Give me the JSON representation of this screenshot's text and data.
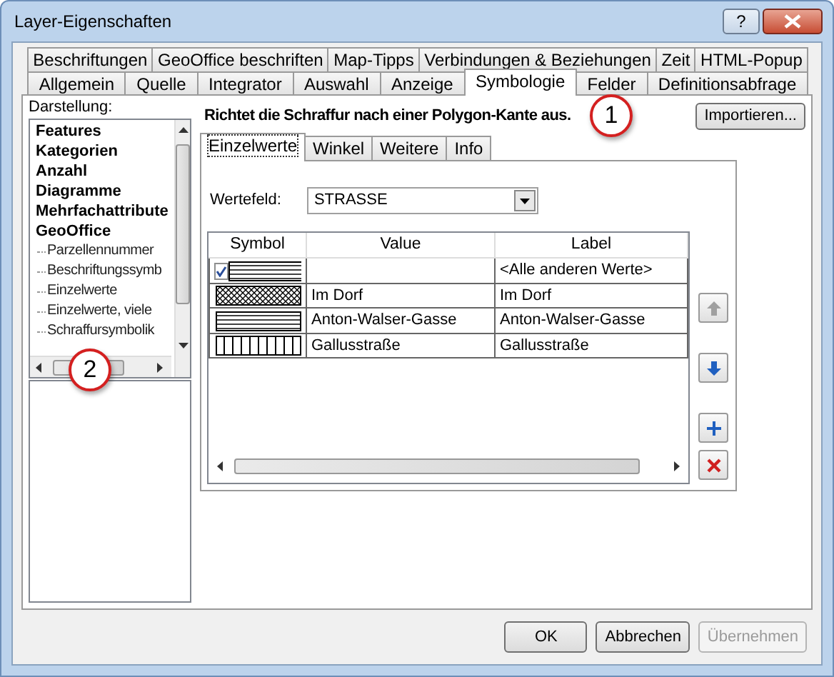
{
  "window": {
    "title": "Layer-Eigenschaften",
    "help": "?"
  },
  "tab_rows": [
    [
      {
        "label": "Beschriftungen",
        "selected": false
      },
      {
        "label": "GeoOffice beschriften",
        "selected": false
      },
      {
        "label": "Map-Tipps",
        "selected": false
      },
      {
        "label": "Verbindungen & Beziehungen",
        "selected": false
      },
      {
        "label": "Zeit",
        "selected": false
      },
      {
        "label": "HTML-Popup",
        "selected": false
      }
    ],
    [
      {
        "label": "Allgemein",
        "selected": false
      },
      {
        "label": "Quelle",
        "selected": false
      },
      {
        "label": "Integrator",
        "selected": false
      },
      {
        "label": "Auswahl",
        "selected": false
      },
      {
        "label": "Anzeige",
        "selected": false
      },
      {
        "label": "Symbologie",
        "selected": true
      },
      {
        "label": "Felder",
        "selected": false
      },
      {
        "label": "Definitionsabfrage",
        "selected": false
      }
    ]
  ],
  "sidebar": {
    "label": "Darstellung:",
    "items": [
      {
        "label": "Features"
      },
      {
        "label": "Kategorien"
      },
      {
        "label": "Anzahl"
      },
      {
        "label": "Diagramme"
      },
      {
        "label": "Mehrfachattribute"
      },
      {
        "label": "GeoOffice",
        "children": [
          {
            "label": "Parzellennummer"
          },
          {
            "label": "Beschriftungssymb"
          },
          {
            "label": "Einzelwerte"
          },
          {
            "label": "Einzelwerte, viele"
          },
          {
            "label": "Schraffursymbolik"
          }
        ]
      }
    ]
  },
  "description": "Richtet die Schraffur nach einer Polygon-Kante aus.",
  "import_button": "Importieren...",
  "inner_tabs": [
    {
      "label": "Einzelwerte",
      "selected": true
    },
    {
      "label": "Winkel",
      "selected": false
    },
    {
      "label": "Weitere",
      "selected": false
    },
    {
      "label": "Info",
      "selected": false
    }
  ],
  "value_field": {
    "label": "Wertefeld:",
    "value": "STRASSE"
  },
  "table": {
    "columns": [
      "Symbol",
      "Value",
      "Label"
    ],
    "rows": [
      {
        "kind": "horizontal",
        "checked": true,
        "label": "<Alle anderen Werte>"
      },
      {
        "kind": "crosshatch",
        "value": "Im Dorf",
        "label": "Im Dorf"
      },
      {
        "kind": "horizontal",
        "value": "Anton-Walser-Gasse",
        "label": "Anton-Walser-Gasse"
      },
      {
        "kind": "vertical",
        "value": "Gallusstraße",
        "label": "Gallusstraße"
      }
    ]
  },
  "tools": [
    {
      "kind": "up",
      "disabled": true
    },
    {
      "kind": "down",
      "disabled": false
    },
    {
      "kind": "add",
      "disabled": false
    },
    {
      "kind": "remove",
      "disabled": false
    }
  ],
  "callouts": [
    "1",
    "2"
  ],
  "buttons": [
    {
      "label": "OK",
      "disabled": false
    },
    {
      "label": "Abbrechen",
      "disabled": false
    },
    {
      "label": "Übernehmen",
      "disabled": true
    }
  ]
}
